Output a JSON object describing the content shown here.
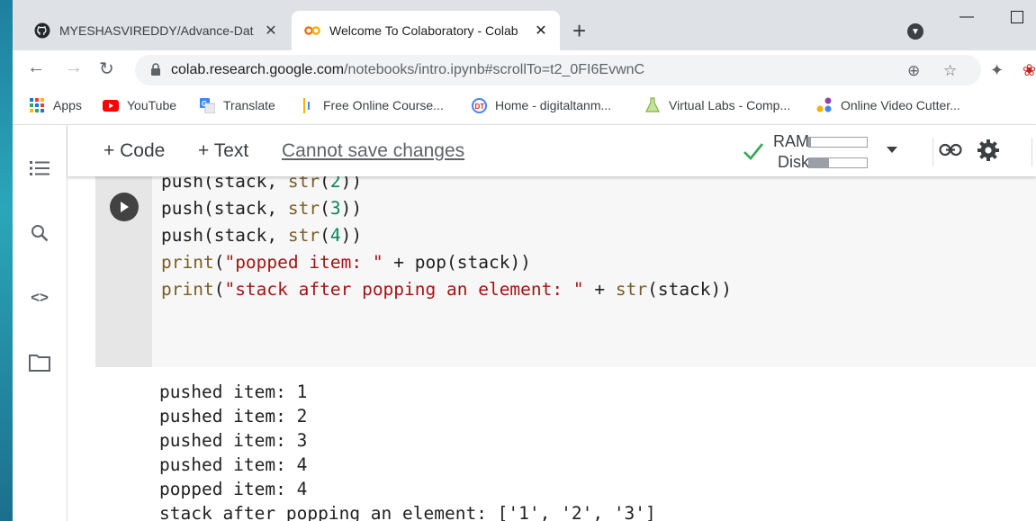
{
  "browser": {
    "tabs": [
      {
        "title": "MYESHASVIREDDY/Advance-Dat",
        "favicon": "github-icon",
        "active": false
      },
      {
        "title": "Welcome To Colaboratory - Colab",
        "favicon": "colab-icon",
        "active": true
      }
    ],
    "new_tab": "+",
    "url_host": "colab.research.google.com",
    "url_path": "/notebooks/intro.ipynb#scrollTo=t2_0FI6EvwnC",
    "bookmarks": [
      {
        "label": "Apps",
        "icon": "apps-grid-icon"
      },
      {
        "label": "YouTube",
        "icon": "youtube-icon"
      },
      {
        "label": "Translate",
        "icon": "translate-icon"
      },
      {
        "label": "Free Online Course...",
        "icon": "course-icon"
      },
      {
        "label": "Home - digitaltanm...",
        "icon": "digital-icon"
      },
      {
        "label": "Virtual Labs - Comp...",
        "icon": "flask-icon"
      },
      {
        "label": "Online Video Cutter...",
        "icon": "video-cutter-icon"
      }
    ]
  },
  "colab": {
    "toolbar": {
      "code_button": "+ Code",
      "text_button": "+ Text",
      "save_status": "Cannot save changes",
      "ram_label": "RAM",
      "disk_label": "Disk",
      "ram_usage": 0.03,
      "disk_usage": 0.35
    },
    "code_lines": [
      "push(stack, str(2))",
      "push(stack, str(3))",
      "push(stack, str(4))",
      "print(\"popped item: \" + pop(stack))",
      "print(\"stack after popping an element: \" + str(stack))"
    ],
    "output_lines": [
      "pushed item: 1",
      "pushed item: 2",
      "pushed item: 3",
      "pushed item: 4",
      "popped item: 4",
      "stack after popping an element: ['1', '2', '3']"
    ]
  }
}
